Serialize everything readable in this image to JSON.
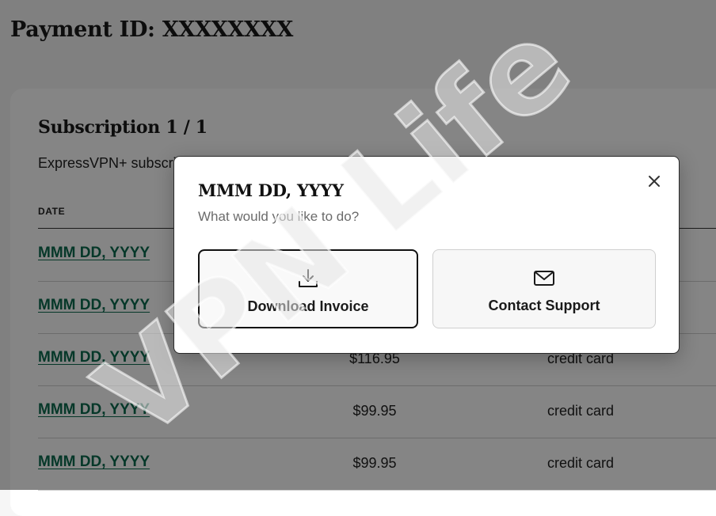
{
  "page": {
    "title": "Payment ID: XXXXXXXX"
  },
  "subscription": {
    "heading": "Subscription 1 / 1",
    "name": "ExpressVPN+ subscription",
    "columns": {
      "date": "DATE"
    },
    "rows": [
      {
        "date": "MMM DD, YYYY",
        "amount": "",
        "method": ""
      },
      {
        "date": "MMM DD, YYYY",
        "amount": "",
        "method": ""
      },
      {
        "date": "MMM DD, YYYY",
        "amount": "$116.95",
        "method": "credit card"
      },
      {
        "date": "MMM DD, YYYY",
        "amount": "$99.95",
        "method": "credit card"
      },
      {
        "date": "MMM DD, YYYY",
        "amount": "$99.95",
        "method": "credit card"
      }
    ]
  },
  "modal": {
    "title": "MMM DD, YYYY",
    "subtitle": "What would you like to do?",
    "close_icon": "close-icon",
    "actions": [
      {
        "label": "Download Invoice",
        "icon": "download-icon"
      },
      {
        "label": "Contact Support",
        "icon": "mail-icon"
      }
    ]
  },
  "watermark": {
    "text": "VPN Life"
  },
  "colors": {
    "link": "#0c6b4f",
    "overlay": "rgba(0,0,0,0.48)"
  }
}
